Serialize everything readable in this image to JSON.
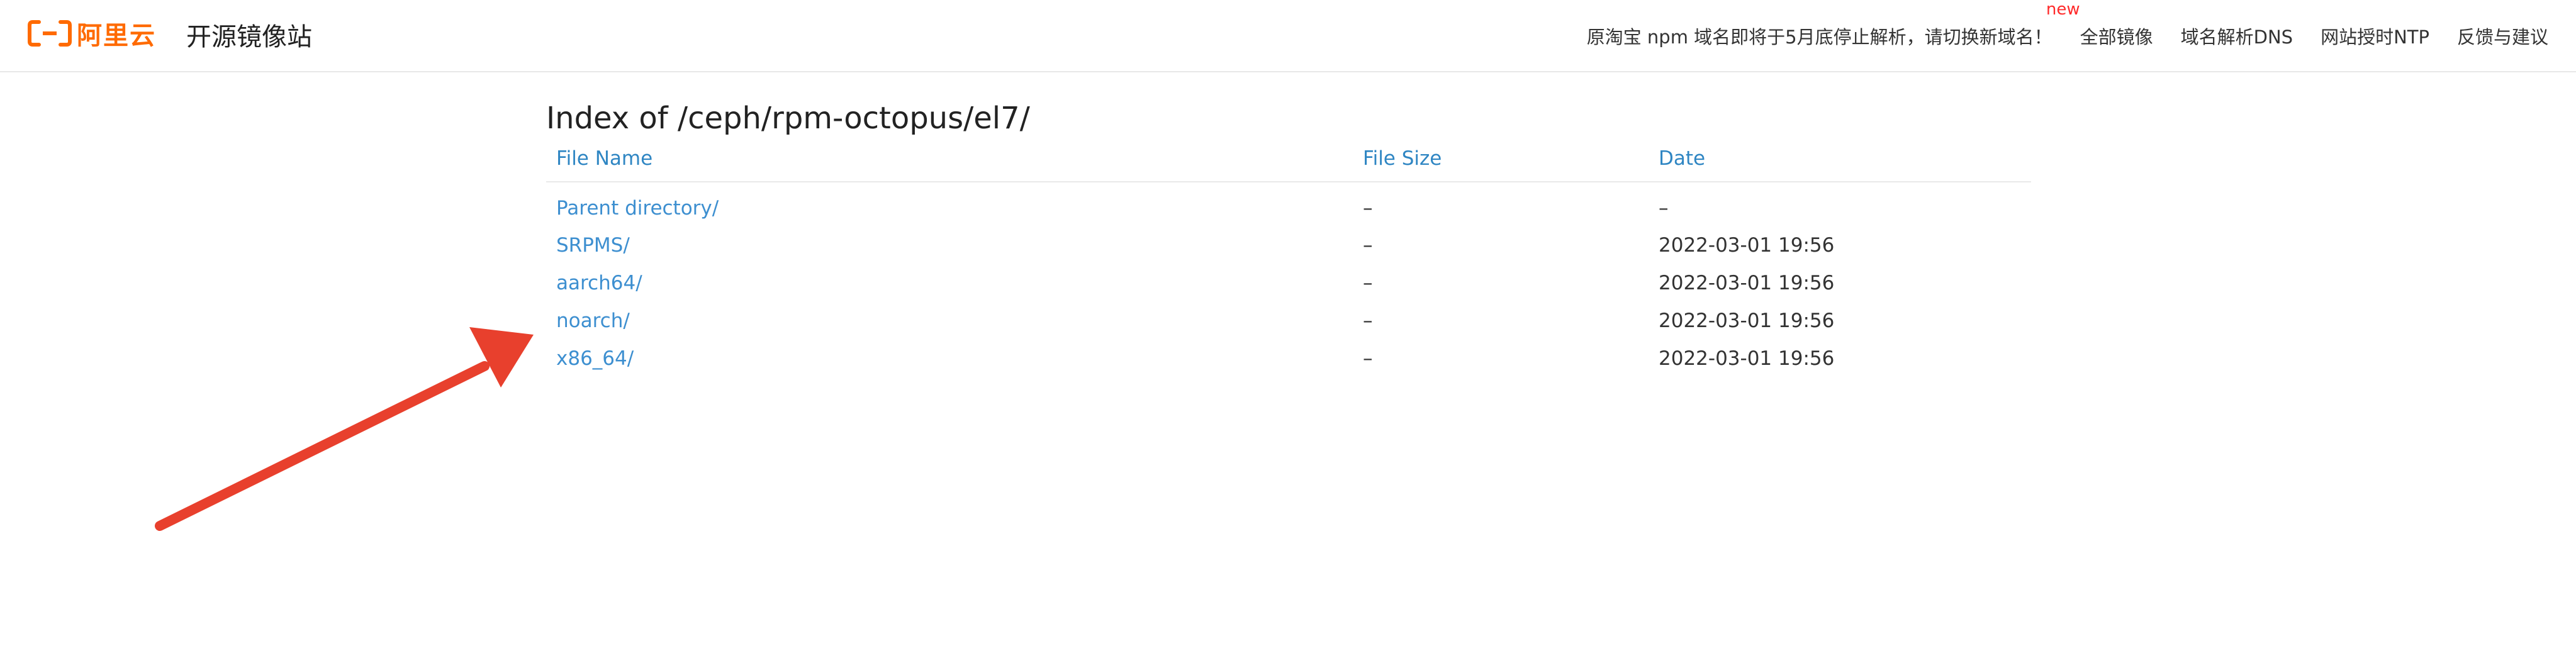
{
  "header": {
    "logo_text": "阿里云",
    "site_title": "开源镜像站",
    "nav": [
      {
        "label": "原淘宝 npm 域名即将于5月底停止解析，请切换新域名！",
        "badge": "new"
      },
      {
        "label": "全部镜像"
      },
      {
        "label": "域名解析DNS"
      },
      {
        "label": "网站授时NTP"
      },
      {
        "label": "反馈与建议"
      }
    ]
  },
  "colors": {
    "brand": "#ff6a00",
    "link": "#3d8fd0",
    "header_link": "#2f86c3",
    "badge": "#ff2a2a",
    "arrow": "#e8402d"
  },
  "main": {
    "title": "Index of /ceph/rpm-octopus/el7/",
    "columns": [
      "File Name",
      "File Size",
      "Date"
    ],
    "rows": [
      {
        "name": "Parent directory/",
        "size": "–",
        "date": "–"
      },
      {
        "name": "SRPMS/",
        "size": "–",
        "date": "2022-03-01 19:56"
      },
      {
        "name": "aarch64/",
        "size": "–",
        "date": "2022-03-01 19:56"
      },
      {
        "name": "noarch/",
        "size": "–",
        "date": "2022-03-01 19:56"
      },
      {
        "name": "x86_64/",
        "size": "–",
        "date": "2022-03-01 19:56"
      }
    ]
  },
  "annotation": {
    "icon": "red-arrow-icon"
  }
}
